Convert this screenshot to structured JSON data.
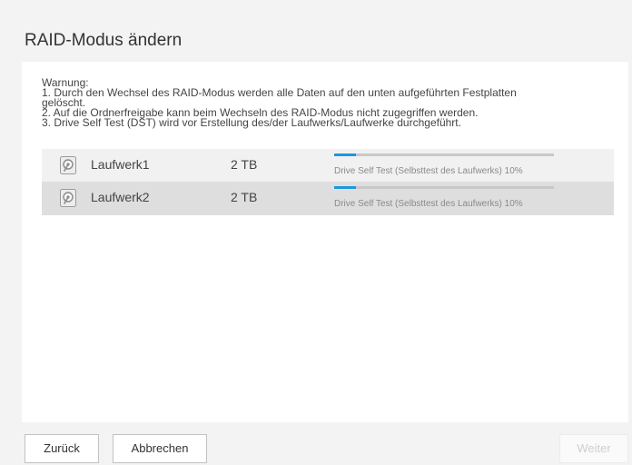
{
  "dialog": {
    "title": "RAID-Modus ändern"
  },
  "warning": {
    "heading": "Warnung:",
    "lines": [
      "1. Durch den Wechsel des RAID-Modus werden alle Daten auf den unten aufgeführten Festplatten",
      "gelöscht.",
      "2. Auf die Ordnerfreigabe kann beim Wechseln des RAID-Modus nicht zugegriffen werden.",
      "3. Drive Self Test (DST) wird vor Erstellung des/der Laufwerks/Laufwerke durchgeführt."
    ]
  },
  "drives": [
    {
      "name": "Laufwerk1",
      "size": "2 TB",
      "status": "Drive Self Test (Selbsttest des Laufwerks) 10%",
      "progress": 0.1,
      "icon": "hard-drive-icon"
    },
    {
      "name": "Laufwerk2",
      "size": "2 TB",
      "status": "Drive Self Test (Selbsttest des Laufwerks) 10%",
      "progress": 0.1,
      "icon": "hard-drive-icon"
    }
  ],
  "buttons": {
    "back": "Zurück",
    "cancel": "Abbrechen",
    "next": "Weiter"
  },
  "colors": {
    "background": "#f3f3f3",
    "panel": "#ffffff",
    "progress_fill": "#1e96e0",
    "progress_track": "#c8c8c8",
    "row1": "#f1f1f1",
    "row2": "#dedede",
    "disabled_text": "#cfcfcf"
  }
}
